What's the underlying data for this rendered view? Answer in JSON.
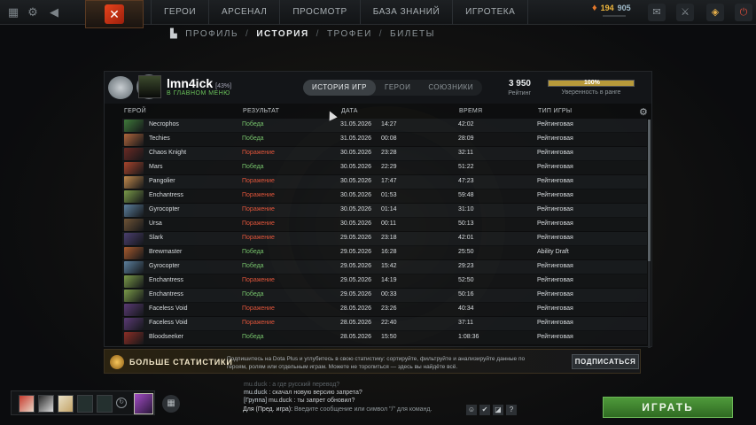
{
  "topbar": {
    "nav": [
      "ГЕРОИ",
      "АРСЕНАЛ",
      "ПРОСМОТР",
      "БАЗА ЗНАНИЙ",
      "ИГРОТЕКА"
    ],
    "gold": "194",
    "shards": "905"
  },
  "breadcrumbs": [
    "ПРОФИЛЬ",
    "ИСТОРИЯ",
    "ТРОФЕИ",
    "БИЛЕТЫ"
  ],
  "profile": {
    "name": "lmn4ick",
    "tag": "[43%]",
    "status": "В ГЛАВНОМ МЕНЮ",
    "tabs": [
      "ИСТОРИЯ ИГР",
      "ГЕРОИ",
      "СОЮЗНИКИ"
    ],
    "rating_value": "3 950",
    "rating_label": "Рейтинг",
    "confidence_value": "100%",
    "confidence_fill": 1.0,
    "confidence_label": "Уверенность в ранге"
  },
  "columns": {
    "hero": "ГЕРОЙ",
    "result": "РЕЗУЛЬТАТ",
    "date": "ДАТА",
    "duration": "ВРЕМЯ",
    "type": "ТИП ИГРЫ"
  },
  "matches": [
    {
      "hero": "Necrophos",
      "result": "Победа",
      "win": true,
      "date": "31.05.2026",
      "time": "14:27",
      "duration": "42:02",
      "type": "Рейтинговая",
      "color": "#3f7a3a"
    },
    {
      "hero": "Techies",
      "result": "Победа",
      "win": true,
      "date": "31.05.2026",
      "time": "00:08",
      "duration": "28:09",
      "type": "Рейтинговая",
      "color": "#b0663c"
    },
    {
      "hero": "Chaos Knight",
      "result": "Поражение",
      "win": false,
      "date": "30.05.2026",
      "time": "23:28",
      "duration": "32:11",
      "type": "Рейтинговая",
      "color": "#6a2a24"
    },
    {
      "hero": "Mars",
      "result": "Победа",
      "win": true,
      "date": "30.05.2026",
      "time": "22:29",
      "duration": "51:22",
      "type": "Рейтинговая",
      "color": "#a8442c"
    },
    {
      "hero": "Pangolier",
      "result": "Поражение",
      "win": false,
      "date": "30.05.2026",
      "time": "17:47",
      "duration": "47:23",
      "type": "Рейтинговая",
      "color": "#c28a4c"
    },
    {
      "hero": "Enchantress",
      "result": "Поражение",
      "win": false,
      "date": "30.05.2026",
      "time": "01:53",
      "duration": "59:48",
      "type": "Рейтинговая",
      "color": "#7a9a48"
    },
    {
      "hero": "Gyrocopter",
      "result": "Поражение",
      "win": false,
      "date": "30.05.2026",
      "time": "01:14",
      "duration": "31:10",
      "type": "Рейтинговая",
      "color": "#5c7f9c"
    },
    {
      "hero": "Ursa",
      "result": "Поражение",
      "win": false,
      "date": "30.05.2026",
      "time": "00:11",
      "duration": "50:13",
      "type": "Рейтинговая",
      "color": "#6e5336"
    },
    {
      "hero": "Slark",
      "result": "Поражение",
      "win": false,
      "date": "29.05.2026",
      "time": "23:18",
      "duration": "42:01",
      "type": "Рейтинговая",
      "color": "#4a3e6e"
    },
    {
      "hero": "Brewmaster",
      "result": "Победа",
      "win": true,
      "date": "29.05.2026",
      "time": "16:28",
      "duration": "25:50",
      "type": "Ability Draft",
      "color": "#a65a2e"
    },
    {
      "hero": "Gyrocopter",
      "result": "Победа",
      "win": true,
      "date": "29.05.2026",
      "time": "15:42",
      "duration": "29:23",
      "type": "Рейтинговая",
      "color": "#5c7f9c"
    },
    {
      "hero": "Enchantress",
      "result": "Поражение",
      "win": false,
      "date": "29.05.2026",
      "time": "14:19",
      "duration": "52:50",
      "type": "Рейтинговая",
      "color": "#7a9a48"
    },
    {
      "hero": "Enchantress",
      "result": "Победа",
      "win": true,
      "date": "29.05.2026",
      "time": "00:33",
      "duration": "50:16",
      "type": "Рейтинговая",
      "color": "#7a9a48"
    },
    {
      "hero": "Faceless Void",
      "result": "Поражение",
      "win": false,
      "date": "28.05.2026",
      "time": "23:26",
      "duration": "40:34",
      "type": "Рейтинговая",
      "color": "#5a3a74"
    },
    {
      "hero": "Faceless Void",
      "result": "Поражение",
      "win": false,
      "date": "28.05.2026",
      "time": "22:40",
      "duration": "37:11",
      "type": "Рейтинговая",
      "color": "#5a3a74"
    },
    {
      "hero": "Bloodseeker",
      "result": "Победа",
      "win": true,
      "date": "28.05.2026",
      "time": "15:50",
      "duration": "1:08:36",
      "type": "Рейтинговая",
      "color": "#8c2e26"
    }
  ],
  "promo": {
    "title": "БОЛЬШЕ СТАТИСТИКИ",
    "text": "Подпишитесь на Dota Plus и углубитесь в свою статистику: сортируйте, фильтруйте и анализируйте данные по героям, ролям или отдельным играм. Можете не торопиться — здесь вы найдёте всё.",
    "button": "ПОДПИСАТЬСЯ"
  },
  "chat": {
    "faded": "mu.duck : а где русский перевод?",
    "lines": [
      {
        "name": "mu.duck",
        "text": ": скачал новую версию запрета?"
      },
      {
        "name": "[Группа]",
        "text": "mu.duck : ты запрет обновил?"
      }
    ],
    "input_channel": "Для (Пред. игра):",
    "input_placeholder": "Введите сообщение или символ \"/\" для команд."
  },
  "play_button": "ИГРАТЬ"
}
